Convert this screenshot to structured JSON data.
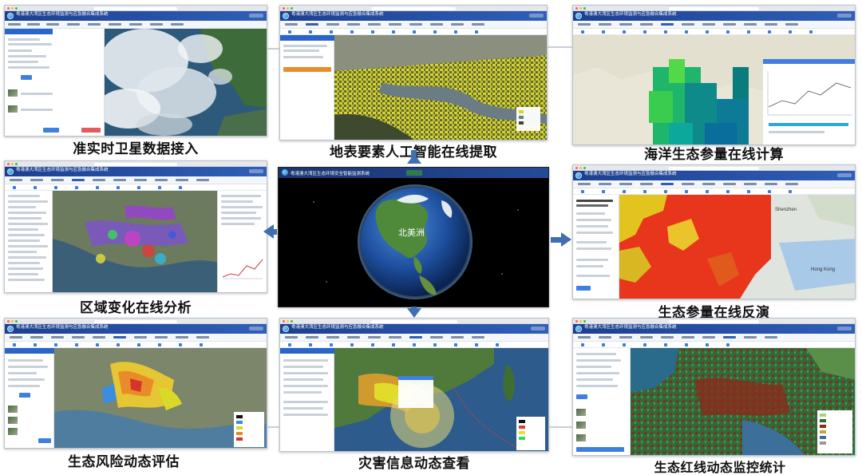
{
  "app_title": "粤港澳大湾区生态环境监测与应急融合集成系统",
  "center_title": "粤港澳大湾区生态环境安全智能监测系统",
  "globe_label": "北美洲",
  "captions": {
    "satellite": "准实时卫星数据接入",
    "ai_extract": "地表要素人工智能在线提取",
    "ocean": "海洋生态参量在线计算",
    "region_change": "区域变化在线分析",
    "eco_inversion": "生态参量在线反演",
    "eco_risk": "生态风险动态评估",
    "disaster": "灾害信息动态查看",
    "redline": "生态红线动态监控统计"
  },
  "map_labels": {
    "shenzhen": "Shenzhen",
    "hong_kong": "Hong Kong"
  },
  "colors": {
    "accent": "#2f5fb8",
    "arrow": "#3f6fb0",
    "eco_red": "#e8361c",
    "eco_yellow": "#e3c41e",
    "redline_brown": "#8a2c1c"
  }
}
